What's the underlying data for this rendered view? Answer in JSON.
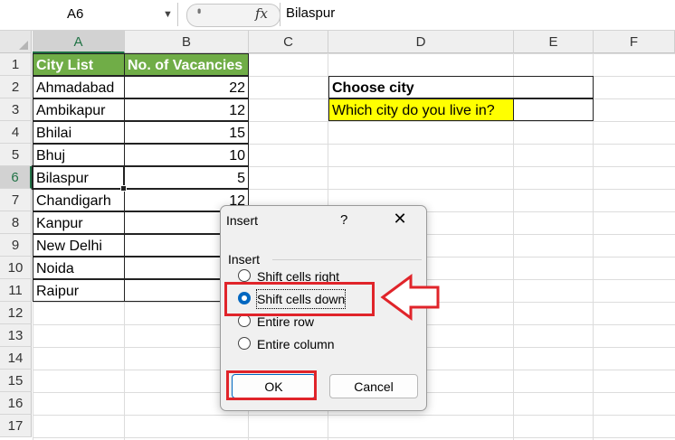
{
  "formula_bar": {
    "name_box": "A6",
    "fx_label": "fx",
    "content": "Bilaspur"
  },
  "columns": [
    "A",
    "B",
    "C",
    "D",
    "E",
    "F"
  ],
  "rows": [
    "1",
    "2",
    "3",
    "4",
    "5",
    "6",
    "7",
    "8",
    "9",
    "10",
    "11",
    "12",
    "13",
    "14",
    "15",
    "16",
    "17"
  ],
  "selected_cell": "A6",
  "table": {
    "header_city": "City List",
    "header_vacancies": "No. of Vacancies",
    "rows": [
      {
        "city": "Ahmadabad",
        "vacancies": "22"
      },
      {
        "city": "Ambikapur",
        "vacancies": "12"
      },
      {
        "city": "Bhilai",
        "vacancies": "15"
      },
      {
        "city": "Bhuj",
        "vacancies": "10"
      },
      {
        "city": "Bilaspur",
        "vacancies": "5"
      },
      {
        "city": "Chandigarh",
        "vacancies": "12"
      },
      {
        "city": "Kanpur",
        "vacancies": ""
      },
      {
        "city": "New Delhi",
        "vacancies": ""
      },
      {
        "city": "Noida",
        "vacancies": ""
      },
      {
        "city": "Raipur",
        "vacancies": ""
      }
    ]
  },
  "choose_box": {
    "title": "Choose city",
    "prompt": "Which city do you live in?"
  },
  "dialog": {
    "title": "Insert",
    "help": "?",
    "close": "✕",
    "group_label": "Insert",
    "options": [
      {
        "label": "Shift cells right",
        "selected": false
      },
      {
        "label": "Shift cells down",
        "selected": true
      },
      {
        "label": "Entire row",
        "selected": false
      },
      {
        "label": "Entire column",
        "selected": false
      }
    ],
    "ok_label": "OK",
    "cancel_label": "Cancel"
  },
  "colors": {
    "header_fill": "#70ad47",
    "prompt_fill": "#ffff00",
    "annotation_red": "#e0242a",
    "excel_green": "#217346",
    "accent_blue": "#0067c0"
  }
}
